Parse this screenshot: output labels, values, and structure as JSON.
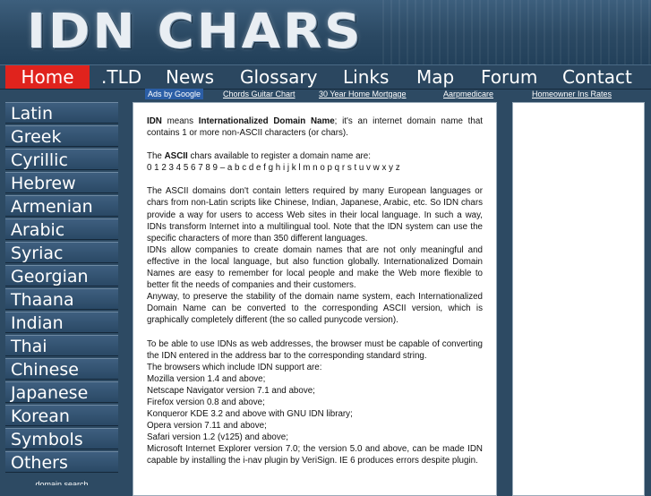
{
  "logo": {
    "text": "IDN CHARS"
  },
  "topnav": [
    {
      "label": "Home",
      "active": true
    },
    {
      "label": ".TLD"
    },
    {
      "label": "News"
    },
    {
      "label": "Glossary"
    },
    {
      "label": "Links"
    },
    {
      "label": "Map"
    },
    {
      "label": "Forum"
    },
    {
      "label": "Contact"
    }
  ],
  "sidebar": {
    "items": [
      "Latin",
      "Greek",
      "Cyrillic",
      "Hebrew",
      "Armenian",
      "Arabic",
      "Syriac",
      "Georgian",
      "Thaana",
      "Indian",
      "Thai",
      "Chinese",
      "Japanese",
      "Korean",
      "Symbols",
      "Others"
    ],
    "cut_text": "domain search"
  },
  "ads": {
    "ads_by": "Ads by Google",
    "links": [
      "Chords Guitar Chart",
      "30 Year Home Mortgage",
      "Aarpmedicare",
      "Homeowner Ins Rates"
    ]
  },
  "content": {
    "p1_idn": "IDN",
    "p1_means": " means ",
    "p1_term": "Internationalized Domain Name",
    "p1_rest": "; it's an internet domain name that contains 1 or more non-ASCII characters (or chars).",
    "p2_pre": "The ",
    "p2_ascii": "ASCII",
    "p2_rest": " chars available to register a domain name are:",
    "p2_chars": "0 1 2 3 4 5 6 7 8 9 – a b c d e f g h i j k l m n o p q r s t u v w x y z",
    "p3": "The ASCII domains don't contain letters required by many European languages or chars from non-Latin scripts like Chinese, Indian, Japanese, Arabic, etc. So IDN chars provide a way for users to access Web sites in their local language. In such a way, IDNs transform Internet into a multilingual tool. Note that the IDN system can use the specific characters of more than 350 different languages.",
    "p4": "IDNs allow companies to create domain names that are not only meaningful and effective in the local language, but also function globally. Internationalized Domain Names are easy to remember for local people and make the Web more flexible to better fit the needs of companies and their customers.",
    "p5": "Anyway, to preserve the stability of the domain name system, each Internationalized Domain Name can be converted to the corresponding ASCII version, which is graphically completely different (the so called punycode version).",
    "p6": "To be able to use IDNs as web addresses, the browser must be capable of converting the IDN entered in the address bar to the corresponding standard string.",
    "browsers_intro": "The browsers which include IDN support are:",
    "browsers": [
      "Mozilla version 1.4 and above;",
      "Netscape Navigator version 7.1 and above;",
      "Firefox version 0.8 and above;",
      "Konqueror KDE 3.2 and above with GNU IDN library;",
      "Opera version 7.11 and above;",
      "Safari version 1.2 (v125) and above;",
      "Microsoft Internet Explorer version 7.0; the version 5.0 and above, can be made IDN capable by installing the i-nav plugin by VeriSign. IE 6 produces errors despite plugin."
    ]
  }
}
